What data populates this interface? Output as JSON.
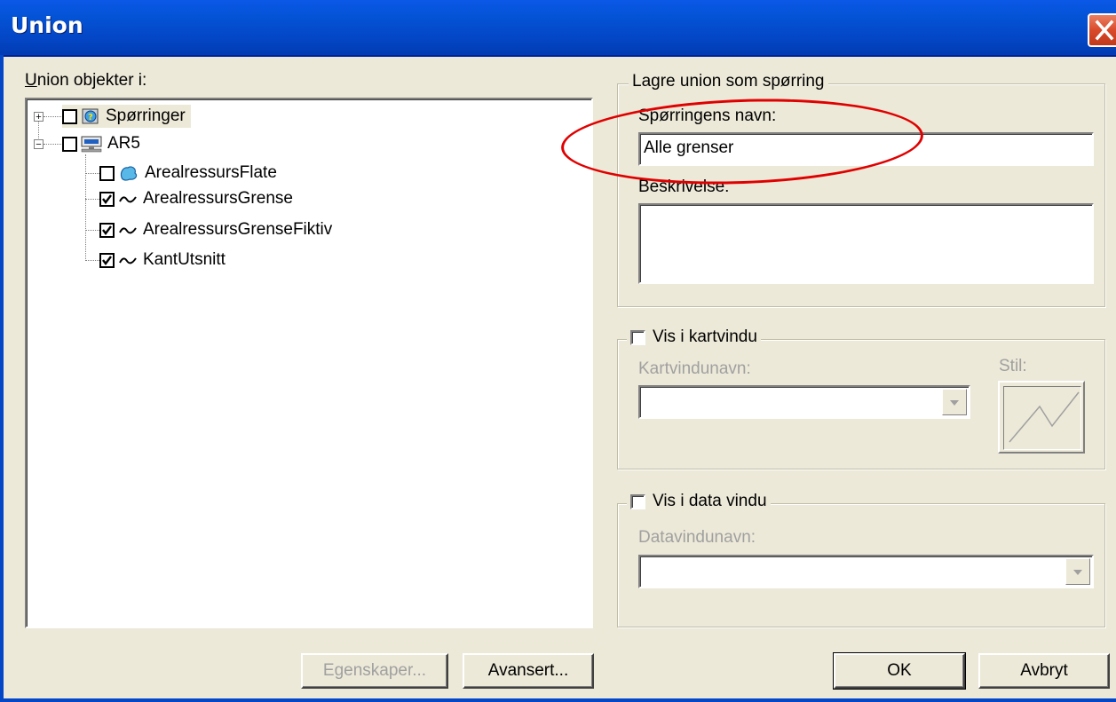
{
  "window": {
    "title": "Union"
  },
  "left": {
    "label": "Union objekter i:",
    "tree": [
      {
        "label": "Spørringer",
        "expander": "+",
        "checked": false,
        "icon": "query-folder-icon"
      },
      {
        "label": "AR5",
        "expander": "−",
        "checked": false,
        "icon": "database-server-icon"
      },
      {
        "label": "ArealressursFlate",
        "checked": false,
        "icon": "polygon-area-icon"
      },
      {
        "label": "ArealressursGrense",
        "checked": true,
        "icon": "line-icon"
      },
      {
        "label": "ArealressursGrenseFiktiv",
        "checked": true,
        "icon": "line-icon"
      },
      {
        "label": "KantUtsnitt",
        "checked": true,
        "icon": "line-icon"
      }
    ],
    "buttons": {
      "properties": "Egenskaper...",
      "advanced": "Avansert..."
    }
  },
  "save_group": {
    "title": "Lagre union som spørring",
    "name_label": "Spørringens navn:",
    "name_value": "Alle grenser",
    "description_label": "Beskrivelse:",
    "description_value": ""
  },
  "map_group": {
    "checkbox_label": "Vis i kartvindu",
    "checked": false,
    "window_name_label": "Kartvindunavn:",
    "style_label": "Stil:"
  },
  "data_group": {
    "checkbox_label": "Vis i data vindu",
    "checked": false,
    "window_name_label": "Datavindunavn:"
  },
  "footer": {
    "ok": "OK",
    "cancel": "Avbryt"
  },
  "colors": {
    "titlebar": "#0453d6",
    "annotation": "#e00000",
    "face": "#ece9d8"
  }
}
